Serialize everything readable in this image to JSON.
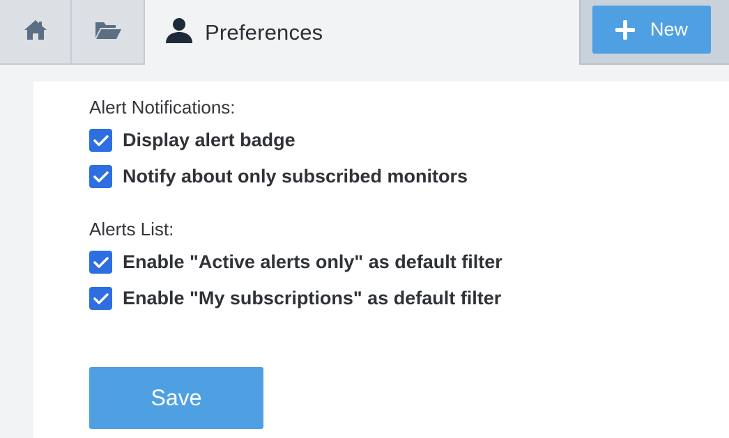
{
  "header": {
    "tabs": [
      {
        "icon": "home-icon"
      },
      {
        "icon": "folder-icon"
      }
    ],
    "active_tab": {
      "icon": "user-icon",
      "title": "Preferences"
    },
    "new_button": {
      "icon": "plus-icon",
      "label": "New"
    }
  },
  "preferences": {
    "alert_notifications": {
      "heading": "Alert Notifications:",
      "options": [
        {
          "label": "Display alert badge",
          "checked": true
        },
        {
          "label": "Notify about only subscribed monitors",
          "checked": true
        }
      ]
    },
    "alerts_list": {
      "heading": "Alerts List:",
      "options": [
        {
          "label": "Enable \"Active alerts only\" as default filter",
          "checked": true
        },
        {
          "label": "Enable \"My subscriptions\" as default filter",
          "checked": true
        }
      ]
    },
    "save_label": "Save"
  },
  "colors": {
    "accent": "#4fa0e3",
    "checkbox": "#2d6fe0",
    "tab_bg": "#dcdfe3",
    "page_bg": "#f2f3f5"
  }
}
